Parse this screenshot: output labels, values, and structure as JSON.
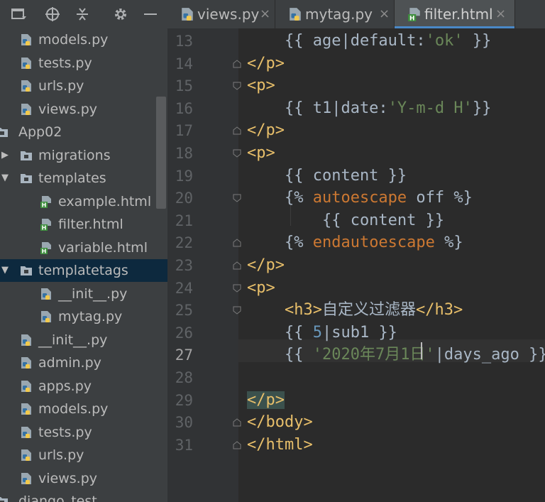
{
  "sidebar": {
    "tree": [
      {
        "label": "models.py",
        "type": "py"
      },
      {
        "label": "tests.py",
        "type": "py"
      },
      {
        "label": "urls.py",
        "type": "py"
      },
      {
        "label": "views.py",
        "type": "py"
      },
      {
        "label": "App02",
        "type": "folder"
      },
      {
        "label": "migrations",
        "type": "folder"
      },
      {
        "label": "templates",
        "type": "folder"
      },
      {
        "label": "example.html",
        "type": "html"
      },
      {
        "label": "filter.html",
        "type": "html"
      },
      {
        "label": "variable.html",
        "type": "html"
      },
      {
        "label": "templatetags",
        "type": "folder"
      },
      {
        "label": "__init__.py",
        "type": "py"
      },
      {
        "label": "mytag.py",
        "type": "py"
      },
      {
        "label": "__init__.py",
        "type": "py"
      },
      {
        "label": "admin.py",
        "type": "py"
      },
      {
        "label": "apps.py",
        "type": "py"
      },
      {
        "label": "models.py",
        "type": "py"
      },
      {
        "label": "tests.py",
        "type": "py"
      },
      {
        "label": "urls.py",
        "type": "py"
      },
      {
        "label": "views.py",
        "type": "py"
      },
      {
        "label": "django_test",
        "type": "folder"
      }
    ],
    "selected_item": "templatetags"
  },
  "tabs": [
    {
      "label": "views.py",
      "icon": "python-file-icon",
      "active": false
    },
    {
      "label": "mytag.py",
      "icon": "python-file-icon",
      "active": false
    },
    {
      "label": "filter.html",
      "icon": "html-file-icon",
      "active": true
    }
  ],
  "tab_close_glyph": "×",
  "editor": {
    "current_line": "27",
    "lines": [
      {
        "n": "13",
        "parts": [
          [
            "t",
            "    {{ age|default:"
          ],
          [
            "s",
            "'ok'"
          ],
          [
            "t",
            " }}"
          ]
        ]
      },
      {
        "n": "14",
        "parts": [
          [
            "g",
            "</p>"
          ]
        ]
      },
      {
        "n": "15",
        "parts": [
          [
            "g",
            "<p>"
          ]
        ]
      },
      {
        "n": "16",
        "parts": [
          [
            "t",
            "    {{ t1|date:"
          ],
          [
            "s",
            "'Y-m-d H'"
          ],
          [
            "t",
            "}}"
          ]
        ]
      },
      {
        "n": "17",
        "parts": [
          [
            "g",
            "</p>"
          ]
        ]
      },
      {
        "n": "18",
        "parts": [
          [
            "g",
            "<p>"
          ]
        ]
      },
      {
        "n": "19",
        "parts": [
          [
            "t",
            "    {{ content }}"
          ]
        ]
      },
      {
        "n": "20",
        "parts": [
          [
            "t",
            "    {% "
          ],
          [
            "k",
            "autoescape"
          ],
          [
            "t",
            " off %}"
          ]
        ]
      },
      {
        "n": "21",
        "parts": [
          [
            "t",
            "        {{ content }}"
          ]
        ]
      },
      {
        "n": "22",
        "parts": [
          [
            "t",
            "    {% "
          ],
          [
            "k",
            "endautoescape"
          ],
          [
            "t",
            " %}"
          ]
        ]
      },
      {
        "n": "23",
        "parts": [
          [
            "g",
            "</p>"
          ]
        ]
      },
      {
        "n": "24",
        "parts": [
          [
            "g",
            "<p>"
          ]
        ]
      },
      {
        "n": "25",
        "parts": [
          [
            "t",
            "    "
          ],
          [
            "g",
            "<h3>"
          ],
          [
            "t",
            "自定义过滤器"
          ],
          [
            "g",
            "</h3>"
          ]
        ]
      },
      {
        "n": "26",
        "parts": [
          [
            "t",
            "    {{ "
          ],
          [
            "n",
            "5"
          ],
          [
            "t",
            "|sub1 }}"
          ]
        ]
      },
      {
        "n": "27",
        "parts": [
          [
            "t",
            "    {{ "
          ],
          [
            "s",
            "'2020年7月1日'"
          ],
          [
            "t",
            "|days_ago }}"
          ]
        ]
      },
      {
        "n": "28",
        "parts": []
      },
      {
        "n": "29",
        "parts": [
          [
            "h",
            "</p>"
          ]
        ]
      },
      {
        "n": "30",
        "parts": [
          [
            "g",
            "</body>"
          ]
        ]
      },
      {
        "n": "31",
        "parts": [
          [
            "g",
            "</html>"
          ]
        ]
      }
    ]
  },
  "colors": {
    "tag": "#e8bf6a",
    "string": "#6a8759",
    "keyword": "#cc7832",
    "number": "#6897bb",
    "text": "#a9b7c6",
    "sidebar_bg": "#3c3f41",
    "editor_bg": "#2b2b2b",
    "selection": "#0d293e",
    "tab_underline": "#4a88c7"
  }
}
